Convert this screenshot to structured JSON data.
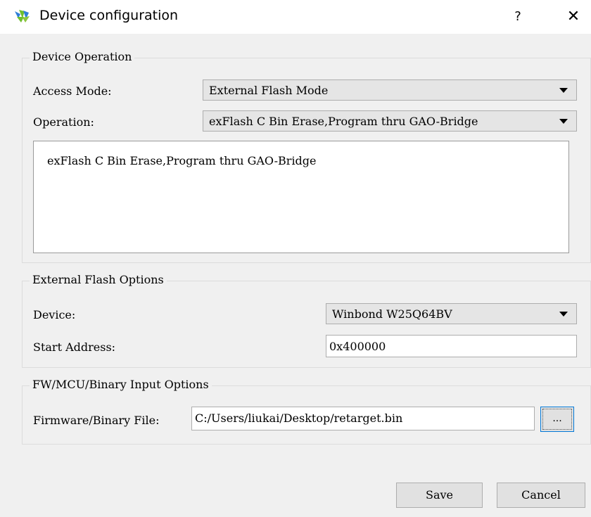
{
  "window": {
    "title": "Device configuration",
    "help_label": "?",
    "close_label": "✕"
  },
  "device_operation": {
    "group_title": "Device Operation",
    "access_mode_label": "Access Mode:",
    "access_mode_value": "External Flash Mode",
    "operation_label": "Operation:",
    "operation_value": "exFlash C Bin Erase,Program thru GAO-Bridge",
    "description": "exFlash C Bin Erase,Program thru GAO-Bridge"
  },
  "external_flash": {
    "group_title": "External Flash Options",
    "device_label": "Device:",
    "device_value": "Winbond W25Q64BV",
    "start_address_label": "Start Address:",
    "start_address_value": "0x400000"
  },
  "fw_options": {
    "group_title": "FW/MCU/Binary Input Options",
    "file_label": "Firmware/Binary File:",
    "file_value": "C:/Users/liukai/Desktop/retarget.bin",
    "browse_label": "..."
  },
  "buttons": {
    "save": "Save",
    "cancel": "Cancel"
  },
  "icons": {
    "app": "gowin-logo-icon",
    "dropdown": "chevron-down-icon"
  },
  "colors": {
    "focus_border": "#0078d7",
    "logo_green": "#6fbf2c",
    "logo_blue": "#2f7fd6"
  }
}
